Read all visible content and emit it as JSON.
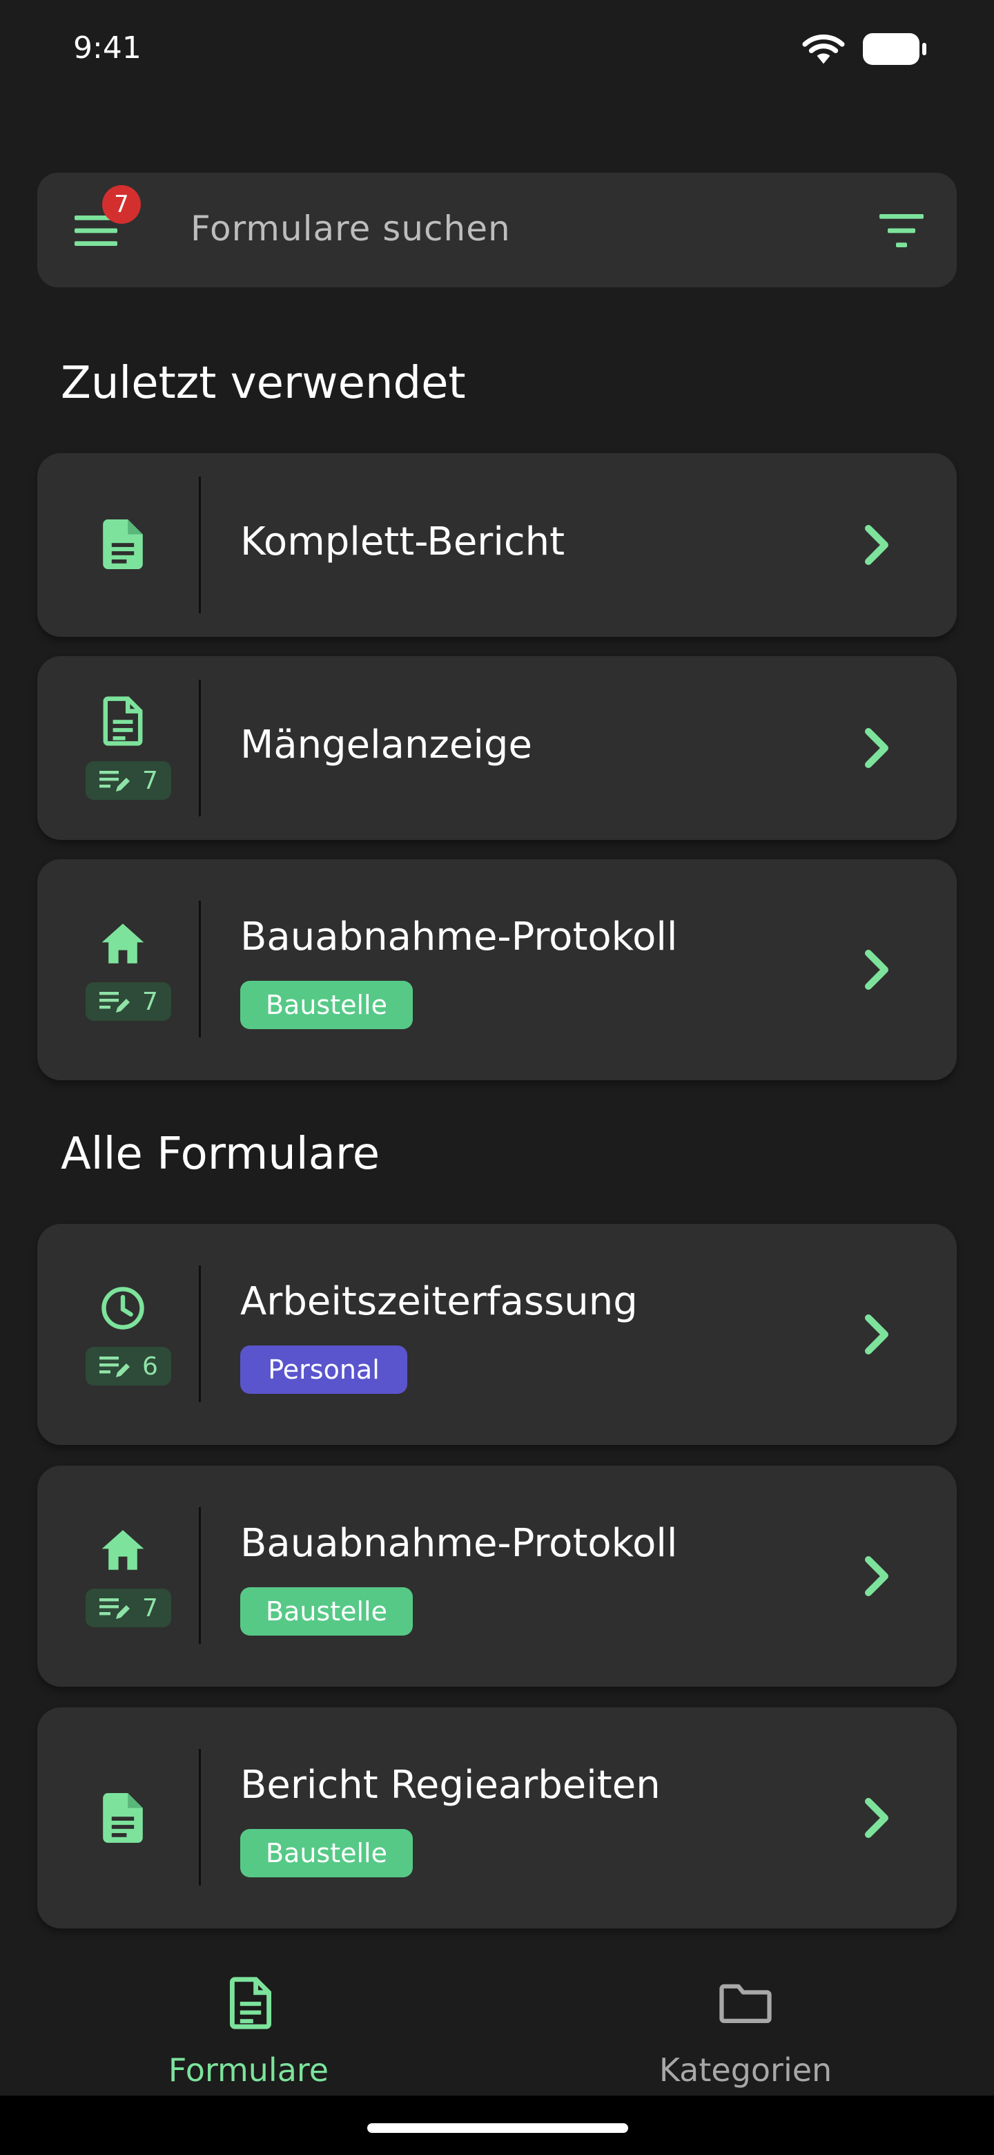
{
  "status_bar": {
    "time": "9:41"
  },
  "search": {
    "placeholder": "Formulare suchen",
    "menu_badge": "7"
  },
  "colors": {
    "accent": "#7de39c",
    "background": "#1c1c1c",
    "card": "#2f2f2f",
    "tag_green": "#56c987",
    "tag_purple": "#5a55cc",
    "badge_red": "#d32f2f"
  },
  "sections": {
    "recent": {
      "title": "Zuletzt verwendet",
      "items": [
        {
          "icon": "document-icon",
          "title": "Komplett-Bericht"
        },
        {
          "icon": "document-outline-icon",
          "title": "Mängelanzeige",
          "count": "7"
        },
        {
          "icon": "home-icon",
          "title": "Bauabnahme-Protokoll",
          "count": "7",
          "tag": "Baustelle"
        }
      ]
    },
    "all": {
      "title": "Alle Formulare",
      "items": [
        {
          "icon": "clock-icon",
          "title": "Arbeitszeiterfassung",
          "count": "6",
          "tag": "Personal"
        },
        {
          "icon": "home-icon",
          "title": "Bauabnahme-Protokoll",
          "count": "7",
          "tag": "Baustelle"
        },
        {
          "icon": "document-icon",
          "title": "Bericht Regiearbeiten",
          "tag": "Baustelle"
        }
      ]
    }
  },
  "bottom_nav": {
    "items": [
      {
        "label": "Formulare",
        "icon": "document-outline-icon",
        "active": true
      },
      {
        "label": "Kategorien",
        "icon": "folder-icon",
        "active": false
      }
    ]
  }
}
